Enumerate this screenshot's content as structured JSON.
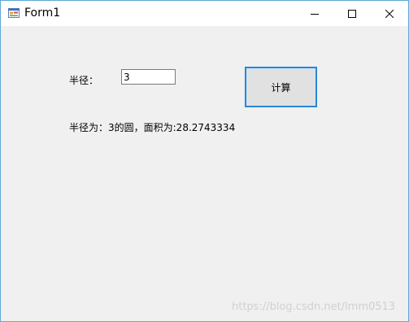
{
  "window": {
    "title": "Form1",
    "icon": "winforms-app-icon",
    "controls": [
      "minimize-icon",
      "maximize-icon",
      "close-icon"
    ]
  },
  "form": {
    "radius_label": "半径：",
    "radius_value": "3",
    "calculate_label": "计算",
    "result_text": "半径为：3的圆，面积为:28.2743334"
  },
  "watermark": "https://blog.csdn.net/lmm0513",
  "colors": {
    "accent": "#2a86d6",
    "window_border": "#5fa8d3",
    "client_bg": "#f0f0f0",
    "button_bg": "#e1e1e1"
  }
}
